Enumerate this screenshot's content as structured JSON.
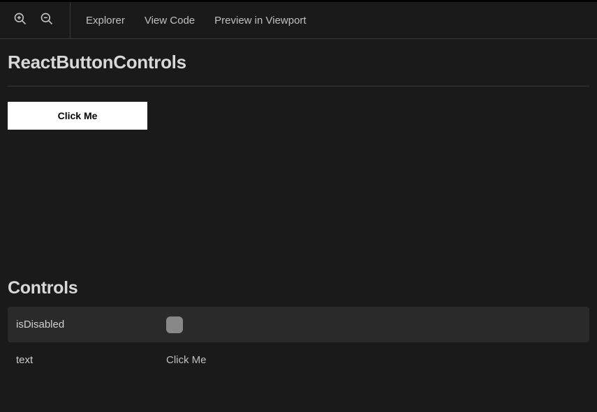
{
  "toolbar": {
    "nav": {
      "explorer": "Explorer",
      "view_code": "View Code",
      "preview_viewport": "Preview in Viewport"
    }
  },
  "page": {
    "title": "ReactButtonControls"
  },
  "demo": {
    "button_text": "Click Me"
  },
  "controls": {
    "title": "Controls",
    "rows": [
      {
        "label": "isDisabled",
        "type": "checkbox",
        "checked": false
      },
      {
        "label": "text",
        "type": "text",
        "value": "Click Me"
      }
    ]
  }
}
